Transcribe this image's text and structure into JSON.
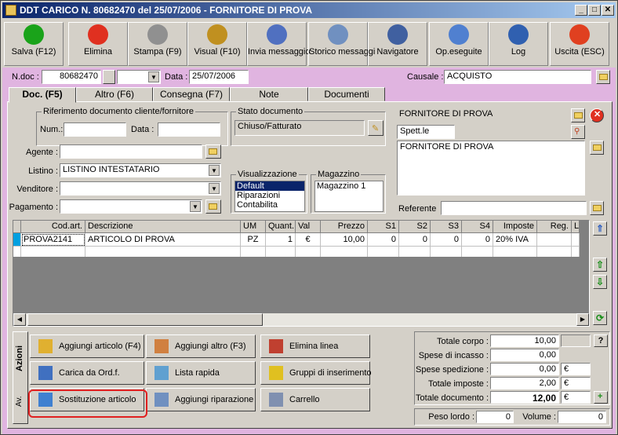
{
  "window": {
    "title": "DDT CARICO N. 80682470  del 25/07/2006 - FORNITORE DI PROVA",
    "min": "_",
    "max": "□",
    "close": "✕"
  },
  "toolbar": [
    {
      "label": "Salva (F12)",
      "icon": "check-icon",
      "color": "#1aa31a"
    },
    {
      "label": "Elimina",
      "icon": "delete-x-icon",
      "color": "#e03020"
    },
    {
      "label": "Stampa (F9)",
      "icon": "printer-icon",
      "color": "#909090"
    },
    {
      "label": "Visual (F10)",
      "icon": "magic-wand-icon",
      "color": "#c09020"
    },
    {
      "label": "Invia messaggio",
      "icon": "send-mail-icon",
      "color": "#5070c0"
    },
    {
      "label": "Storico messaggi",
      "icon": "message-history-icon",
      "color": "#7090c0"
    },
    {
      "label": "Navigatore",
      "icon": "compass-icon",
      "color": "#4060a0"
    },
    {
      "label": "Op.eseguite",
      "icon": "gears-icon",
      "color": "#5080d0"
    },
    {
      "label": "Log",
      "icon": "log-magnifier-icon",
      "color": "#3060b0"
    },
    {
      "label": "Uscita (ESC)",
      "icon": "power-exit-icon",
      "color": "#e04020"
    }
  ],
  "header": {
    "ndoc_label": "N.doc :",
    "ndoc_value": "80682470",
    "data_label": "Data :",
    "data_value": "25/07/2006",
    "causale_label": "Causale :",
    "causale_value": "ACQUISTO"
  },
  "tabs": [
    "Doc. (F5)",
    "Altro (F6)",
    "Consegna (F7)",
    "Note",
    "Documenti"
  ],
  "riferimento": {
    "title": "Riferimento documento cliente/fornitore",
    "num_label": "Num.:",
    "num_value": "",
    "data_label": "Data :",
    "data_value": ""
  },
  "stato": {
    "title": "Stato documento",
    "value": "Chiuso/Fatturato"
  },
  "fornitore": {
    "name": "FORNITORE DI PROVA",
    "salutation": "Spett.le",
    "address": "FORNITORE DI PROVA",
    "referente_label": "Referente",
    "referente_value": ""
  },
  "fields": {
    "agente_label": "Agente :",
    "agente_value": "",
    "listino_label": "Listino :",
    "listino_value": "LISTINO INTESTATARIO",
    "venditore_label": "Venditore :",
    "venditore_value": "",
    "pagamento_label": "Pagamento :",
    "pagamento_value": ""
  },
  "visualizzazione": {
    "title": "Visualizzazione",
    "options": [
      "Default",
      "Riparazioni",
      "Contabilita"
    ]
  },
  "magazzino": {
    "title": "Magazzino",
    "value": "Magazzino 1"
  },
  "grid": {
    "columns": [
      "Cod.art.",
      "Descrizione",
      "UM",
      "Quant.",
      "Val",
      "Prezzo",
      "S1",
      "S2",
      "S3",
      "S4",
      "Imposte",
      "Reg.",
      "L"
    ],
    "rows": [
      [
        "PROVA2141",
        "ARTICOLO DI PROVA",
        "PZ",
        "1",
        "€",
        "10,00",
        "0",
        "0",
        "0",
        "0",
        "20% IVA",
        "",
        ""
      ]
    ]
  },
  "actions_tabs": [
    "Azioni",
    "Av."
  ],
  "actions": [
    {
      "label": "Aggiungi articolo (F4)",
      "icon": "add-article-icon"
    },
    {
      "label": "Aggiungi altro (F3)",
      "icon": "add-other-icon"
    },
    {
      "label": "Elimina linea",
      "icon": "delete-line-icon"
    },
    {
      "label": "Carica da Ord.f.",
      "icon": "load-order-icon"
    },
    {
      "label": "Lista rapida",
      "icon": "quick-list-icon"
    },
    {
      "label": "Gruppi di inserimento",
      "icon": "insert-groups-icon"
    },
    {
      "label": "Sostituzione articolo",
      "icon": "replace-article-icon"
    },
    {
      "label": "Aggiungi riparazione",
      "icon": "add-repair-icon"
    },
    {
      "label": "Carrello",
      "icon": "cart-icon"
    }
  ],
  "totals": {
    "corpo_label": "Totale corpo :",
    "corpo_value": "10,00",
    "incasso_label": "Spese di incasso :",
    "incasso_value": "0,00",
    "spedizione_label": "Spese spedizione :",
    "spedizione_value": "0,00",
    "spedizione_cur": "€",
    "imposte_label": "Totale imposte :",
    "imposte_value": "2,00",
    "imposte_cur": "€",
    "documento_label": "Totale documento :",
    "documento_value": "12,00",
    "documento_cur": "€",
    "help": "?",
    "peso_label": "Peso lordo :",
    "peso_value": "0",
    "volume_label": "Volume :",
    "volume_value": "0"
  }
}
